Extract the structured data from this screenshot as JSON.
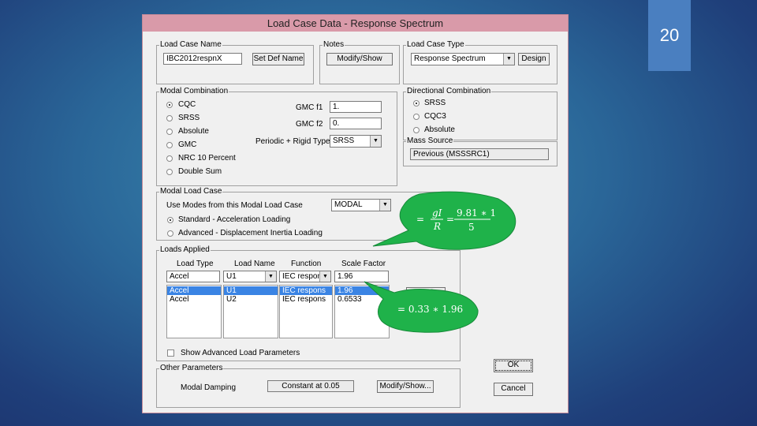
{
  "slide_number": "20",
  "window": {
    "title": "Load Case Data - Response Spectrum"
  },
  "load_case_name": {
    "label": "Load Case Name",
    "value": "IBC2012respnX",
    "set_def_button": "Set Def Name"
  },
  "notes": {
    "label": "Notes",
    "button": "Modify/Show"
  },
  "load_case_type": {
    "label": "Load Case Type",
    "value": "Response Spectrum",
    "design_button": "Design"
  },
  "modal_combination": {
    "label": "Modal Combination",
    "options": [
      "CQC",
      "SRSS",
      "Absolute",
      "GMC",
      "NRC 10 Percent",
      "Double Sum"
    ],
    "selected": 0,
    "gmc_f1_label": "GMC f1",
    "gmc_f1_value": "1.",
    "gmc_f2_label": "GMC f2",
    "gmc_f2_value": "0.",
    "periodic_label": "Periodic + Rigid Type",
    "periodic_value": "SRSS"
  },
  "directional_combination": {
    "label": "Directional Combination",
    "options": [
      "SRSS",
      "CQC3",
      "Absolute"
    ],
    "selected": 0
  },
  "mass_source": {
    "label": "Mass Source",
    "value": "Previous (MSSSRC1)"
  },
  "modal_load_case": {
    "label": "Modal Load Case",
    "use_modes_label": "Use Modes from this Modal Load Case",
    "use_modes_value": "MODAL",
    "options": [
      "Standard - Acceleration Loading",
      "Advanced - Displacement Inertia Loading"
    ],
    "selected": 0
  },
  "loads_applied": {
    "label": "Loads Applied",
    "headers": [
      "Load Type",
      "Load Name",
      "Function",
      "Scale Factor"
    ],
    "edit_row": [
      "Accel",
      "U1",
      "IEC respons",
      "1.96"
    ],
    "rows": [
      [
        "Accel",
        "U1",
        "IEC respons",
        "1.96"
      ],
      [
        "Accel",
        "U2",
        "IEC respons",
        "0.6533"
      ]
    ],
    "add_button": "Add",
    "advanced_label": "Show Advanced Load Parameters"
  },
  "other_parameters": {
    "label": "Other Parameters",
    "modal_damping_label": "Modal Damping",
    "modal_damping_value": "Constant at 0.05",
    "modify_button": "Modify/Show..."
  },
  "ok_button": "OK",
  "cancel_button": "Cancel",
  "annotations": {
    "bubble1_prefix": "=",
    "bubble1_numerator": "gI",
    "bubble1_denominator": "R",
    "bubble1_equals": "=",
    "bubble1_numerator2": "9.81 ∗ 1",
    "bubble1_denominator2": "5",
    "bubble2_text": "= 0.33 ∗ 1.96"
  },
  "colors": {
    "callout_green": "#1fb24a",
    "selection_blue": "#3a84e4",
    "titlebar": "#d99aa9"
  }
}
